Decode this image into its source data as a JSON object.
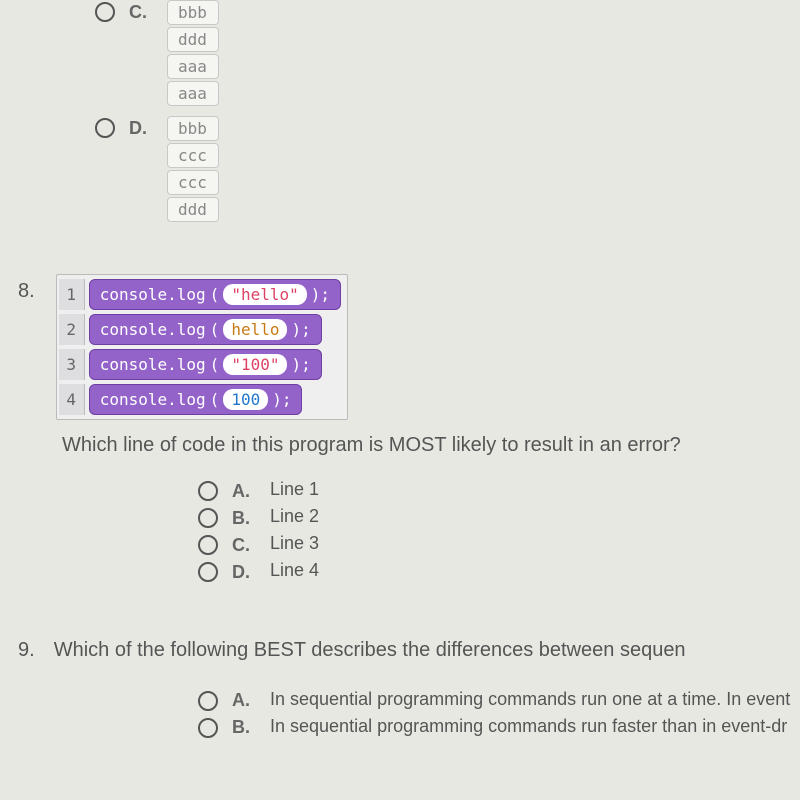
{
  "q7": {
    "optionC": {
      "label": "C.",
      "blocks": [
        "bbb",
        "ddd",
        "aaa",
        "aaa"
      ]
    },
    "optionD": {
      "label": "D.",
      "blocks": [
        "bbb",
        "ccc",
        "ccc",
        "ddd"
      ]
    }
  },
  "q8": {
    "number": "8.",
    "code": [
      {
        "n": "1",
        "prefix": "console.log",
        "open": "(",
        "arg": "\"hello\"",
        "argClass": "",
        "close": ");"
      },
      {
        "n": "2",
        "prefix": "console.log",
        "open": "(",
        "arg": "hello",
        "argClass": "orange",
        "close": ");"
      },
      {
        "n": "3",
        "prefix": "console.log",
        "open": "(",
        "arg": "\"100\"",
        "argClass": "",
        "close": ");"
      },
      {
        "n": "4",
        "prefix": "console.log",
        "open": "(",
        "arg": "100",
        "argClass": "blue",
        "close": ");"
      }
    ],
    "question": "Which line of code in this program is MOST likely to result in an error?",
    "options": [
      {
        "label": "A.",
        "text": "Line 1"
      },
      {
        "label": "B.",
        "text": "Line 2"
      },
      {
        "label": "C.",
        "text": "Line 3"
      },
      {
        "label": "D.",
        "text": "Line 4"
      }
    ]
  },
  "q9": {
    "number": "9.",
    "question": "Which of the following BEST describes the differences between sequen",
    "options": [
      {
        "label": "A.",
        "text": "In sequential programming commands run one at a time. In event"
      },
      {
        "label": "B.",
        "text": "In sequential programming commands run faster than in event-dr"
      }
    ]
  }
}
